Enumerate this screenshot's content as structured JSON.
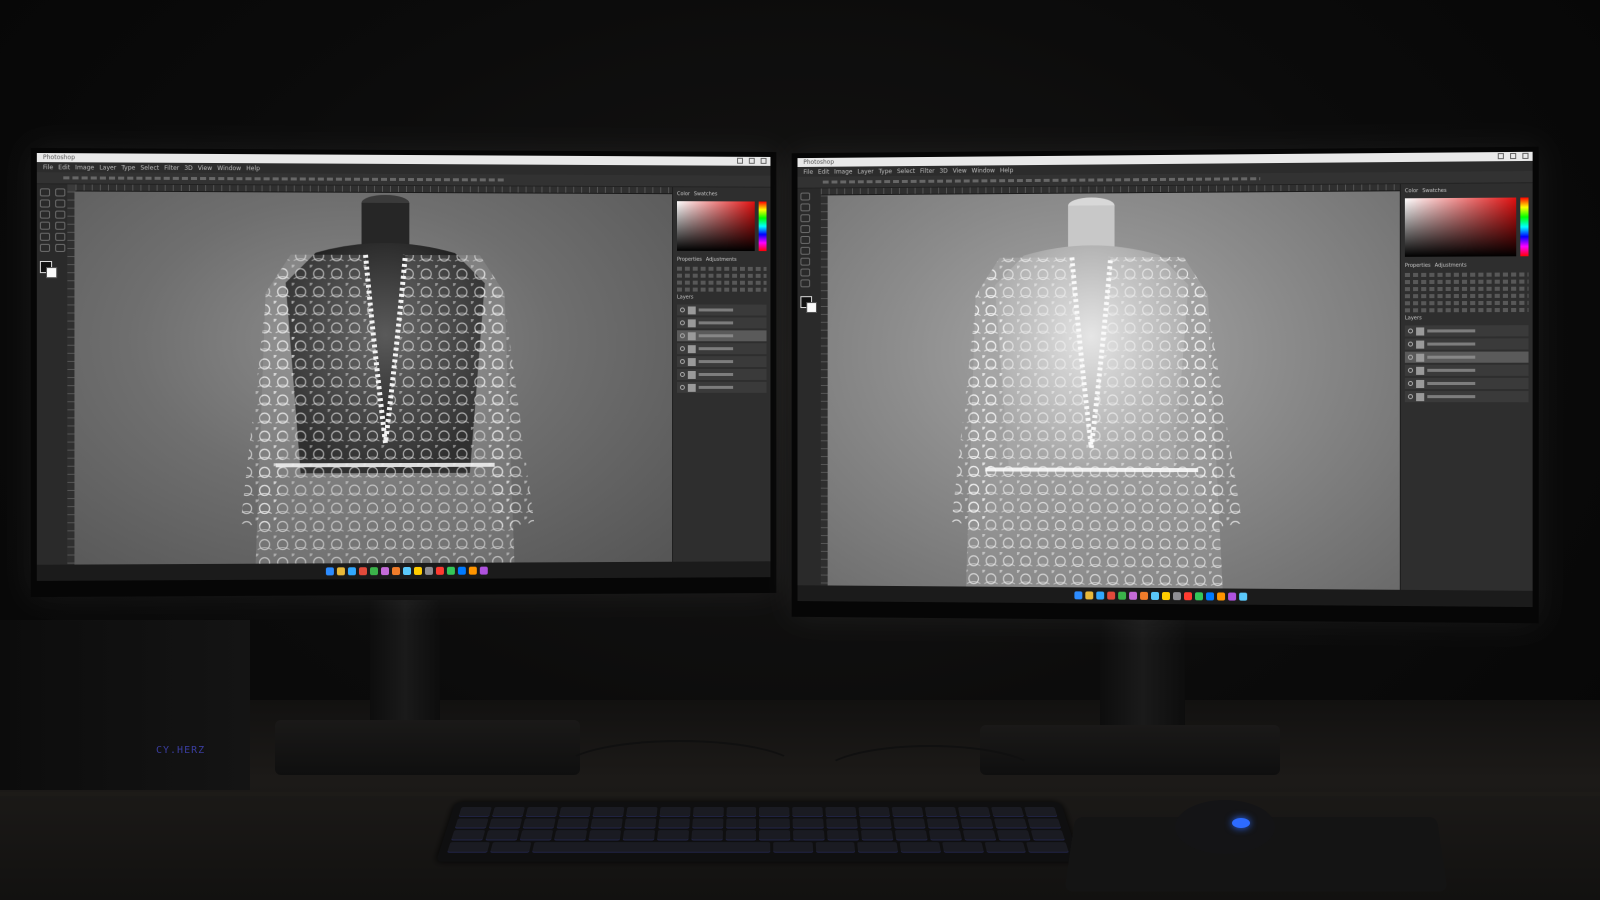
{
  "scene": {
    "desktop_label": "CY.HERZ"
  },
  "left_monitor": {
    "window_title": "Photoshop",
    "menu": [
      "File",
      "Edit",
      "Image",
      "Layer",
      "Type",
      "Select",
      "Filter",
      "3D",
      "View",
      "Window",
      "Help"
    ],
    "panel_tabs": [
      "Color",
      "Swatches",
      "Properties",
      "Adjustments",
      "Layers"
    ],
    "canvas_style": "dark mannequin"
  },
  "right_monitor": {
    "window_title": "Photoshop",
    "menu": [
      "File",
      "Edit",
      "Image",
      "Layer",
      "Type",
      "Select",
      "Filter",
      "3D",
      "View",
      "Window",
      "Help"
    ],
    "panel_tabs": [
      "Color",
      "Swatches",
      "Properties",
      "Adjustments",
      "Layers"
    ],
    "canvas_style": "light mannequin"
  },
  "colors": {
    "background": "#070707",
    "ui_dark": "#2c2c2c",
    "accent_led": "#2d6bff",
    "picker_red": "#e01010"
  },
  "icons": [
    "move-tool-icon",
    "lasso-icon",
    "brush-icon",
    "eraser-icon",
    "crop-icon",
    "eye-icon",
    "layer-thumbnail-icon"
  ]
}
